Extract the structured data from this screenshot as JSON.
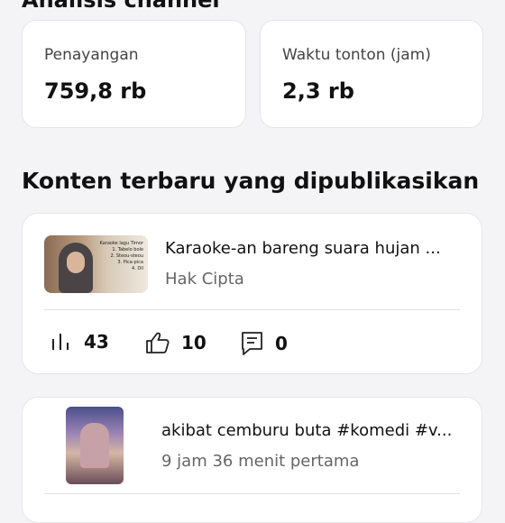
{
  "header": {
    "section_title": "Analisis channel"
  },
  "stats": [
    {
      "label": "Penayangan",
      "value": "759,8 rb"
    },
    {
      "label": "Waktu tonton (jam)",
      "value": "2,3 rb"
    }
  ],
  "recent": {
    "title": "Konten terbaru yang dipublikasikan",
    "items": [
      {
        "title": "Karaoke-an bareng suara hujan ...",
        "subtitle": "Hak Cipta",
        "thumbnail_text": [
          "Karaoke lagu Timor",
          "1. Tabelo bole",
          "2. Steou-steou",
          "3. Pica-pica",
          "4. Dll"
        ],
        "views": "43",
        "likes": "10",
        "comments": "0"
      },
      {
        "title": "akibat cemburu buta #komedi #v...",
        "subtitle": "9 jam 36 menit pertama"
      }
    ]
  },
  "icons": {
    "views": "bar-chart-icon",
    "likes": "thumbs-up-icon",
    "comments": "comment-icon"
  }
}
